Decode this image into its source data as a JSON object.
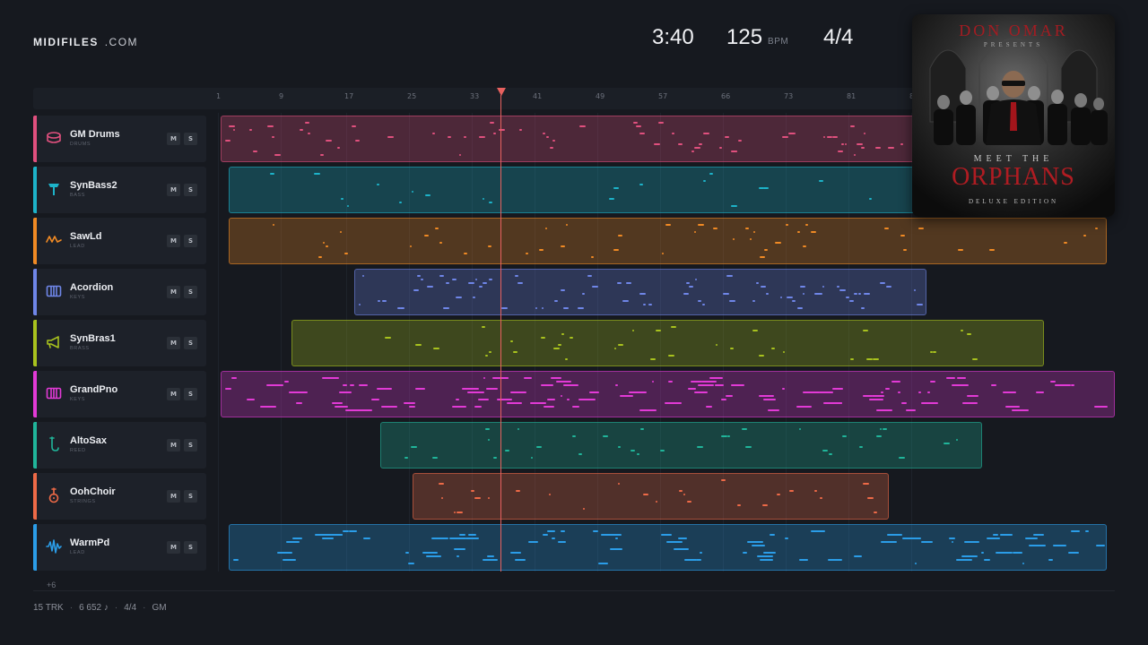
{
  "brand": {
    "name": "MIDIFILES",
    "suffix": ".COM"
  },
  "stats": {
    "duration": "3:40",
    "tempo": "125",
    "tempo_unit": "BPM",
    "time_signature": "4/4"
  },
  "album": {
    "artist": "DON OMAR",
    "presents": "PRESENTS",
    "title_top": "MEET THE",
    "title_main": "ORPHANS",
    "edition": "DELUXE EDITION",
    "accent": "#b01c22"
  },
  "ruler": {
    "ticks": [
      "1",
      "9",
      "17",
      "25",
      "33",
      "41",
      "49",
      "57",
      "66",
      "73",
      "81",
      "89"
    ]
  },
  "playhead": {
    "color": "#e8615f"
  },
  "tracks": [
    {
      "name": "GM Drums",
      "category": "DRUMS",
      "color": "#e0507e",
      "icon": "drum-icon",
      "mute": "M",
      "solo": "S"
    },
    {
      "name": "SynBass2",
      "category": "BASS",
      "color": "#1db3c9",
      "icon": "bass-icon",
      "mute": "M",
      "solo": "S"
    },
    {
      "name": "SawLd",
      "category": "LEAD",
      "color": "#f08a24",
      "icon": "wave-icon",
      "mute": "M",
      "solo": "S"
    },
    {
      "name": "Acordion",
      "category": "KEYS",
      "color": "#6f86e8",
      "icon": "keys-icon",
      "mute": "M",
      "solo": "S"
    },
    {
      "name": "SynBras1",
      "category": "BRASS",
      "color": "#a8c21e",
      "icon": "horn-icon",
      "mute": "M",
      "solo": "S"
    },
    {
      "name": "GrandPno",
      "category": "KEYS",
      "color": "#e23ad6",
      "icon": "keys-icon",
      "mute": "M",
      "solo": "S"
    },
    {
      "name": "AltoSax",
      "category": "REED",
      "color": "#20b59a",
      "icon": "sax-icon",
      "mute": "M",
      "solo": "S"
    },
    {
      "name": "OohChoir",
      "category": "STRINGS",
      "color": "#ee6a47",
      "icon": "guitar-icon",
      "mute": "M",
      "solo": "S"
    },
    {
      "name": "WarmPd",
      "category": "LEAD",
      "color": "#2b9de8",
      "icon": "waveform-icon",
      "mute": "M",
      "solo": "S"
    }
  ],
  "more_tracks": "+6",
  "footer": {
    "tracks": "15 TRK",
    "notes": "6 652 ♪",
    "time_signature": "4/4",
    "standard": "GM"
  }
}
